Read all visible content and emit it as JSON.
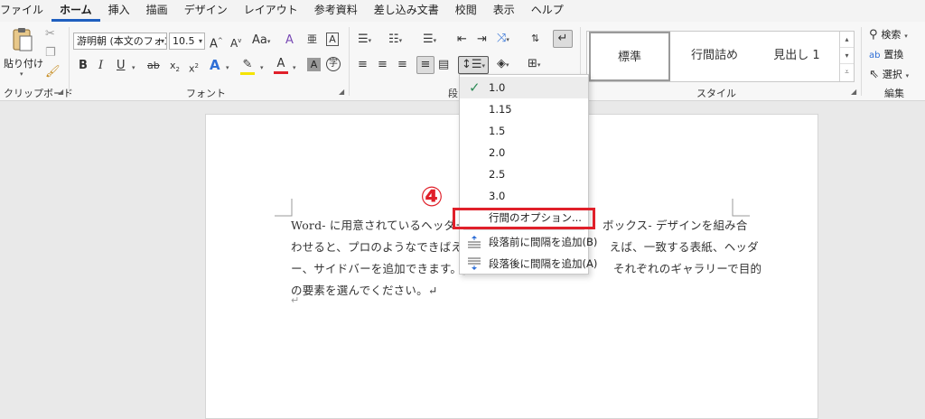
{
  "menu": {
    "items": [
      {
        "label": "ファイル"
      },
      {
        "label": "ホーム",
        "active": true
      },
      {
        "label": "挿入"
      },
      {
        "label": "描画"
      },
      {
        "label": "デザイン"
      },
      {
        "label": "レイアウト"
      },
      {
        "label": "参考資料"
      },
      {
        "label": "差し込み文書"
      },
      {
        "label": "校閲"
      },
      {
        "label": "表示"
      },
      {
        "label": "ヘルプ"
      }
    ]
  },
  "ribbon": {
    "clipboard": {
      "paste_label": "貼り付け",
      "group_label": "クリップボード"
    },
    "font": {
      "font_name": "游明朝 (本文のフォン",
      "font_size": "10.5",
      "group_label": "フォント"
    },
    "paragraph": {
      "group_label": "段"
    },
    "styles": {
      "items": [
        "標準",
        "行間詰め",
        "見出し 1"
      ],
      "group_label": "スタイル"
    },
    "editing": {
      "search_label": "検索",
      "replace_label": "置換",
      "select_label": "選択",
      "group_label": "編集"
    }
  },
  "document": {
    "lines": [
      "Word- に用意されているヘッダー",
      "わせると、プロのようなできばえの",
      "ー、サイドバーを追加できます。[挿",
      "の要素を選んでください。↵"
    ],
    "lines_right": [
      "ボックス- デザインを組み合",
      "えば、一致する表紙、ヘッダ",
      "それぞれのギャラリーで目的",
      ""
    ],
    "para_mark": "↵"
  },
  "line_spacing_menu": {
    "options": [
      "1.0",
      "1.15",
      "1.5",
      "2.0",
      "2.5",
      "3.0"
    ],
    "selected": "1.0",
    "line_options_label": "行間のオプション...",
    "add_before_label": "段落前に間隔を追加(B)",
    "add_after_label": "段落後に間隔を追加(A)"
  },
  "annotation": {
    "step_marker": "④",
    "color": "#e0202a"
  }
}
